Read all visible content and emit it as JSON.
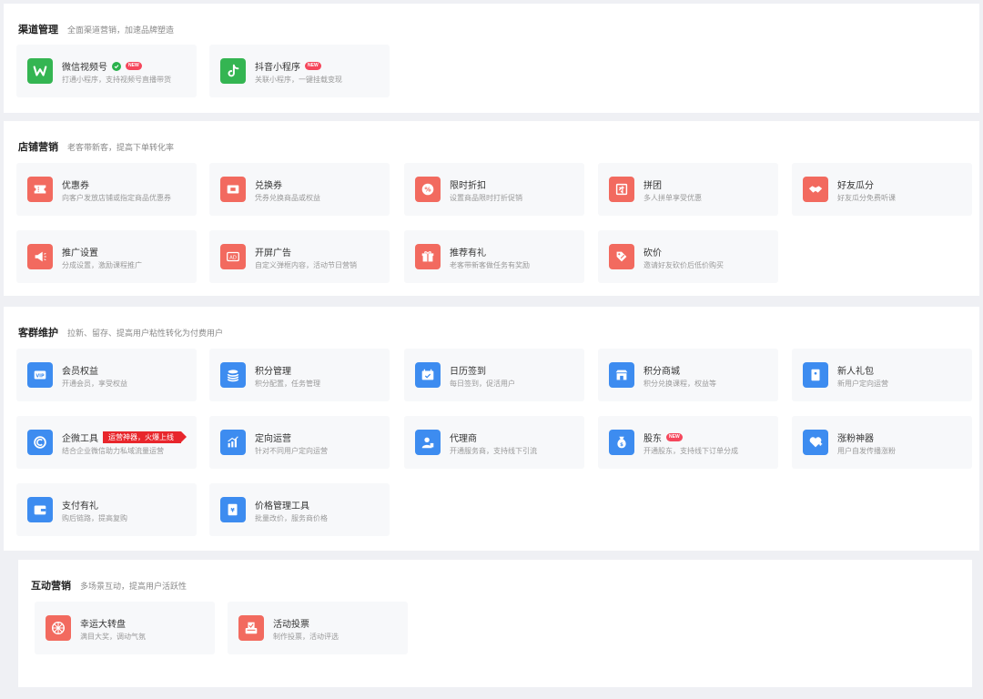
{
  "channel": {
    "title": "渠道管理",
    "subtitle": "全面渠道营销，加速品牌塑造",
    "items": [
      {
        "title": "微信视频号",
        "desc": "打通小程序，支持视频号直播带货",
        "badge": "NEW"
      },
      {
        "title": "抖音小程序",
        "desc": "关联小程序，一键挂载变现",
        "badge": "NEW"
      }
    ]
  },
  "store": {
    "title": "店铺营销",
    "subtitle": "老客带新客，提高下单转化率",
    "items": [
      {
        "title": "优惠券",
        "desc": "向客户发放店铺或指定商品优惠券"
      },
      {
        "title": "兑换券",
        "desc": "凭券兑换商品或权益"
      },
      {
        "title": "限时折扣",
        "desc": "设置商品限时打折促销"
      },
      {
        "title": "拼团",
        "desc": "多人拼单享受优惠"
      },
      {
        "title": "好友瓜分",
        "desc": "好友瓜分免费听课"
      },
      {
        "title": "推广设置",
        "desc": "分成设置，激励课程推广"
      },
      {
        "title": "开屏广告",
        "desc": "自定义弹框内容，活动节日营销",
        "icon_text": "AD"
      },
      {
        "title": "推荐有礼",
        "desc": "老客带新客做任务有奖励"
      },
      {
        "title": "砍价",
        "desc": "邀请好友砍价后低价购买"
      }
    ]
  },
  "customer": {
    "title": "客群维护",
    "subtitle": "拉新、留存、提高用户粘性转化为付费用户",
    "items": [
      {
        "title": "会员权益",
        "desc": "开通会员，享受权益",
        "icon_text": "VIP"
      },
      {
        "title": "积分管理",
        "desc": "积分配置，任务管理"
      },
      {
        "title": "日历签到",
        "desc": "每日签到，促活用户"
      },
      {
        "title": "积分商城",
        "desc": "积分兑换课程，权益等"
      },
      {
        "title": "新人礼包",
        "desc": "新用户定向运营"
      },
      {
        "title": "企微工具",
        "desc": "结合企业微信助力私域流量运营",
        "promo": "运营神器，火爆上线"
      },
      {
        "title": "定向运营",
        "desc": "针对不同用户定向运营"
      },
      {
        "title": "代理商",
        "desc": "开通服务商，支持线下引流"
      },
      {
        "title": "股东",
        "desc": "开通股东，支持线下订单分成",
        "badge": "NEW"
      },
      {
        "title": "涨粉神器",
        "desc": "用户自发传播涨粉"
      },
      {
        "title": "支付有礼",
        "desc": "购后链路，提高复购"
      },
      {
        "title": "价格管理工具",
        "desc": "批量改价，服务商价格",
        "icon_text": "¥"
      }
    ]
  },
  "interaction": {
    "title": "互动营销",
    "subtitle": "多场景互动，提高用户活跃性",
    "items": [
      {
        "title": "幸运大转盘",
        "desc": "满目大奖，调动气氛"
      },
      {
        "title": "活动投票",
        "desc": "制作投票，活动评选"
      }
    ]
  },
  "colors": {
    "green": "#34b552",
    "red": "#f26a5f",
    "blue": "#3d8cf0",
    "badge": "#f5475c"
  }
}
